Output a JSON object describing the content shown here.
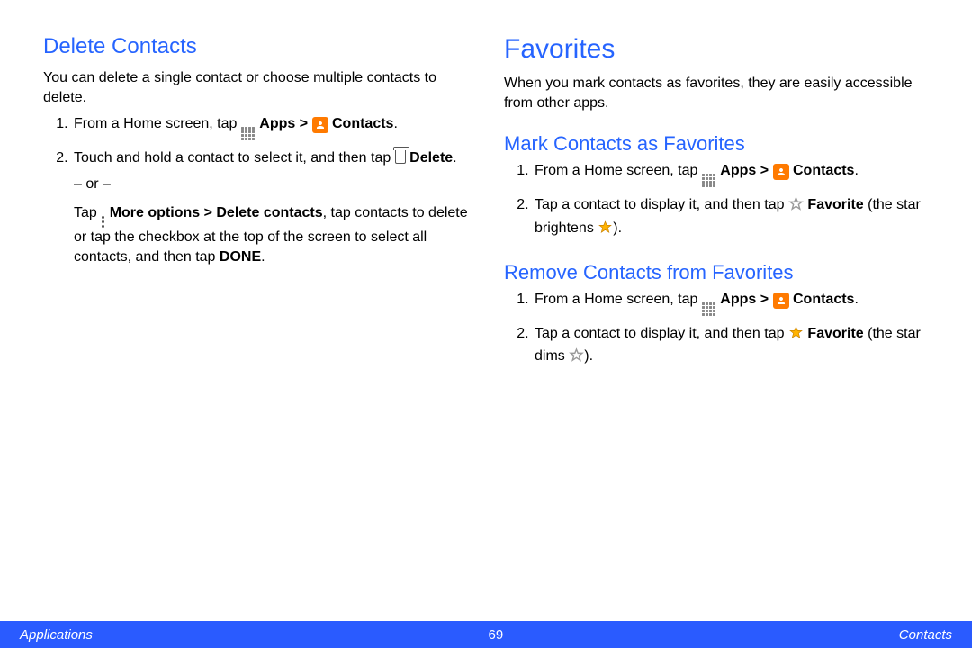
{
  "left": {
    "heading": "Delete Contacts",
    "intro": "You can delete a single contact or choose multiple contacts to delete.",
    "step1_a": "From a Home screen, tap ",
    "apps_label": "Apps",
    "gt": " > ",
    "contacts_label": "Contacts",
    "period": ".",
    "step2_a": "Touch and hold a contact to select it, and then tap ",
    "delete_label": "Delete",
    "or": "– or –",
    "step2_b1": "Tap ",
    "more_label": "More options > Delete contacts",
    "step2_b2": ", tap contacts to delete or tap the checkbox at the top of the screen to select all contacts, and then tap ",
    "done_label": "DONE"
  },
  "right": {
    "heading": "Favorites",
    "intro": "When you mark contacts as favorites, they are easily accessible from other apps.",
    "mark_heading": "Mark Contacts as Favorites",
    "mark_step1": "From a Home screen, tap ",
    "mark_step2_a": "Tap a contact to display it, and then tap ",
    "favorite_label": "Favorite",
    "mark_step2_b": " (the star brightens ",
    "close_paren": ").",
    "remove_heading": "Remove Contacts from Favorites",
    "remove_step1": "From a Home screen, tap ",
    "remove_step2_a": "Tap a contact to display it, and then tap ",
    "remove_step2_b": " (the star dims "
  },
  "footer": {
    "left": "Applications",
    "page": "69",
    "right": "Contacts"
  },
  "colors": {
    "accent": "#2664ff",
    "orange": "#ff7a00",
    "star_gold": "#ffb300"
  }
}
